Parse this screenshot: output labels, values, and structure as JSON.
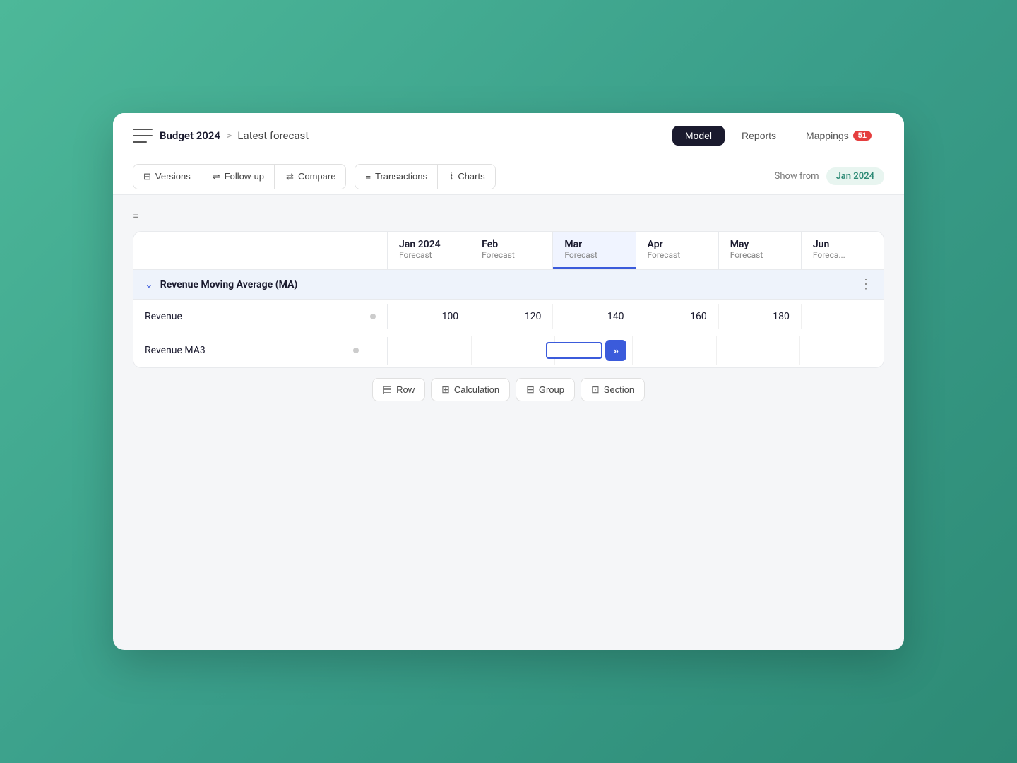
{
  "header": {
    "sidebar_toggle_label": "Toggle sidebar",
    "breadcrumb": {
      "parent": "Budget 2024",
      "separator": ">",
      "current": "Latest forecast"
    },
    "nav": {
      "model_label": "Model",
      "reports_label": "Reports",
      "mappings_label": "Mappings",
      "mappings_badge": "51"
    }
  },
  "toolbar": {
    "versions_label": "Versions",
    "followup_label": "Follow-up",
    "compare_label": "Compare",
    "transactions_label": "Transactions",
    "charts_label": "Charts",
    "show_from_label": "Show from",
    "show_from_value": "Jan 2024"
  },
  "filter": {
    "icon": "="
  },
  "columns": [
    {
      "month": "Jan 2024",
      "sub": "Forecast",
      "active": false
    },
    {
      "month": "Feb",
      "sub": "Forecast",
      "active": false
    },
    {
      "month": "Mar",
      "sub": "Forecast",
      "active": true
    },
    {
      "month": "Apr",
      "sub": "Forecast",
      "active": false
    },
    {
      "month": "May",
      "sub": "Forecast",
      "active": false
    },
    {
      "month": "Jun",
      "sub": "Forecast",
      "active": false
    }
  ],
  "group": {
    "title": "Revenue Moving Average (MA)",
    "chevron": "∨",
    "menu_icon": "⋮"
  },
  "rows": [
    {
      "label": "Revenue",
      "dot": true,
      "cells": [
        "100",
        "120",
        "140",
        "160",
        "180",
        ""
      ]
    },
    {
      "label": "Revenue MA3",
      "dot": true,
      "cells": [
        "",
        "",
        "",
        "",
        "",
        ""
      ],
      "active_cell": 2
    }
  ],
  "add_buttons": [
    {
      "label": "Row",
      "icon": "row"
    },
    {
      "label": "Calculation",
      "icon": "calc"
    },
    {
      "label": "Group",
      "icon": "group"
    },
    {
      "label": "Section",
      "icon": "section"
    }
  ]
}
